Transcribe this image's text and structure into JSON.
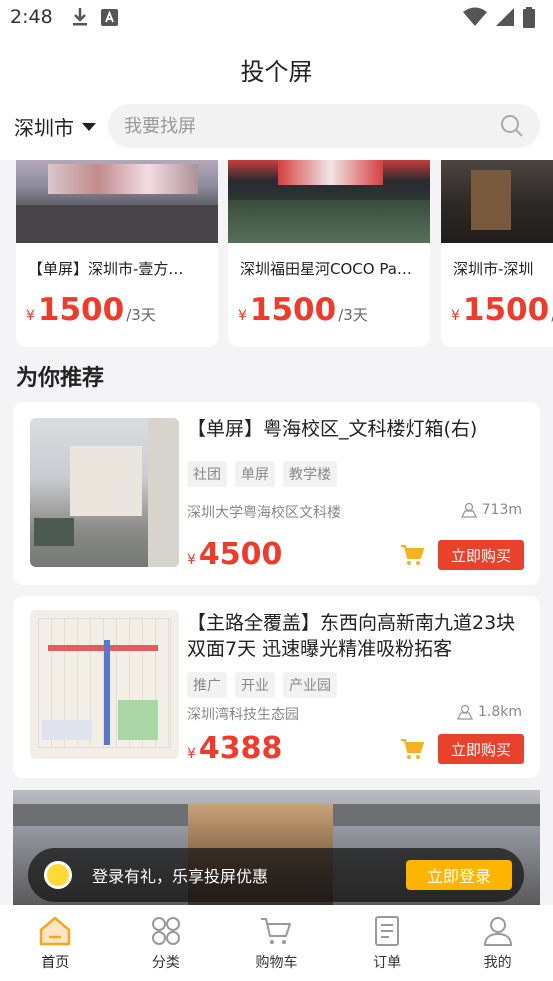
{
  "status": {
    "time": "2:48"
  },
  "app": {
    "title": "投个屏"
  },
  "city": {
    "label": "深圳市"
  },
  "search": {
    "placeholder": "我要找屏"
  },
  "hot": [
    {
      "title": "【单屏】深圳市-壹方…",
      "yen": "¥",
      "price": "1500",
      "unit": "/3天"
    },
    {
      "title": "深圳福田星河COCO Pa…",
      "yen": "¥",
      "price": "1500",
      "unit": "/3天"
    },
    {
      "title": "深圳市-深圳",
      "yen": "¥",
      "price": "1500",
      "unit": "/"
    }
  ],
  "section": {
    "recommend": "为你推荐"
  },
  "items": [
    {
      "title": "【单屏】粤海校区_文科楼灯箱(右)",
      "tags": [
        "社团",
        "单屏",
        "教学楼"
      ],
      "location": "深圳大学粤海校区文科楼",
      "distance": "713m",
      "yen": "¥",
      "price": "4500",
      "buy": "立即购买"
    },
    {
      "title": "【主路全覆盖】东西向高新南九道23块双面7天 迅速曝光精准吸粉拓客",
      "tags": [
        "推广",
        "开业",
        "产业园"
      ],
      "location": "深圳湾科技生态园",
      "distance": "1.8km",
      "yen": "¥",
      "price": "4388",
      "buy": "立即购买"
    }
  ],
  "login": {
    "text": "登录有礼，乐享投屏优惠",
    "button": "立即登录"
  },
  "tabs": [
    {
      "label": "首页",
      "icon": "home-icon",
      "active": true
    },
    {
      "label": "分类",
      "icon": "category-icon"
    },
    {
      "label": "购物车",
      "icon": "cart-icon"
    },
    {
      "label": "订单",
      "icon": "order-icon"
    },
    {
      "label": "我的",
      "icon": "profile-icon"
    }
  ],
  "colors": {
    "accent": "#e8422c",
    "price": "#ee3b2b",
    "login": "#ffb400",
    "cart": "#f5b324",
    "tab_active": "#f5a623"
  }
}
